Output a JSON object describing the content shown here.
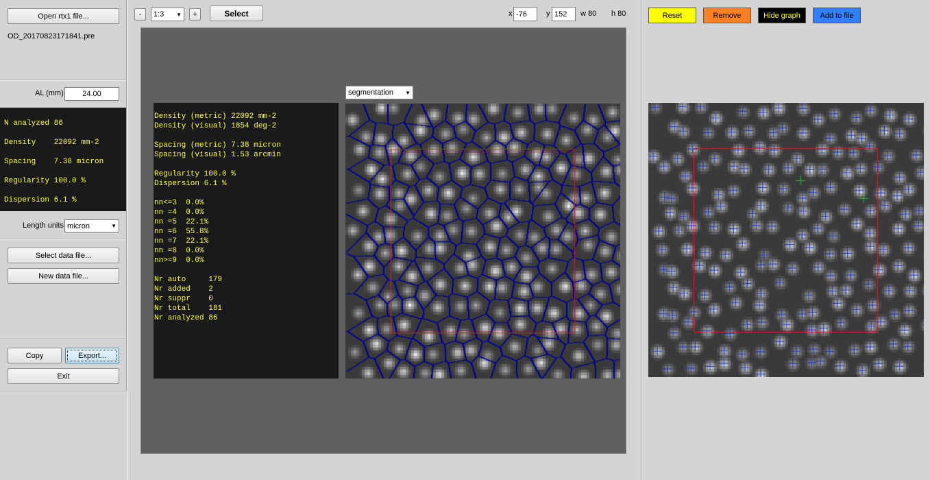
{
  "left": {
    "open_button": "Open rtx1 file...",
    "filename": "OD_20170823171841.pre",
    "al_label": "AL (mm)",
    "al_value": "24.00",
    "stats": [
      {
        "label": "N analyzed",
        "value": "86"
      },
      {
        "label": "Density",
        "value": "22092 mm-2"
      },
      {
        "label": "Spacing",
        "value": "7.38 micron"
      },
      {
        "label": "Regularity",
        "value": "100.0 %"
      },
      {
        "label": "Dispersion",
        "value": "6.1 %"
      }
    ],
    "length_units_label": "Length units",
    "length_units_value": "micron",
    "select_data_button": "Select data file...",
    "new_data_button": "New data file...",
    "copy_button": "Copy",
    "export_button": "Export...",
    "exit_button": "Exit"
  },
  "toolbar": {
    "zoom_out": "-",
    "zoom_value": "1:3",
    "zoom_in": "+",
    "select_button": "Select",
    "x_label": "x",
    "x_value": "-76",
    "y_label": "y",
    "y_value": "152",
    "w_text": "w 80",
    "h_text": "h 80"
  },
  "center": {
    "view_mode": "segmentation",
    "report_lines": [
      "Density (metric) 22092 mm-2",
      "Density (visual) 1854 deg-2",
      "",
      "Spacing (metric) 7.38 micron",
      "Spacing (visual) 1.53 arcmin",
      "",
      "Regularity 100.0 %",
      "Dispersion 6.1 %",
      "",
      "nn<=3  0.0%",
      "nn =4  0.0%",
      "nn =5  22.1%",
      "nn =6  55.8%",
      "nn =7  22.1%",
      "nn =8  0.0%",
      "nn>=9  0.0%",
      "",
      "Nr auto     179",
      "Nr added    2",
      "Nr suppr    0",
      "Nr total    181",
      "Nr analyzed 86"
    ]
  },
  "right": {
    "reset_button": "Reset",
    "remove_button": "Remove",
    "hide_graph_button": "Hide graph",
    "add_to_file_button": "Add to file"
  },
  "colors": {
    "reset": "#ffff00",
    "remove": "#ff8020",
    "hide_graph_bg": "#000000",
    "hide_graph_text": "#ffff00",
    "add_to_file": "#3080ff",
    "report_text": "#ffff40",
    "voronoi_edge": "#000090",
    "roi_box": "#d02020",
    "marker": "#1030c0",
    "marker_added": "#20c040"
  }
}
